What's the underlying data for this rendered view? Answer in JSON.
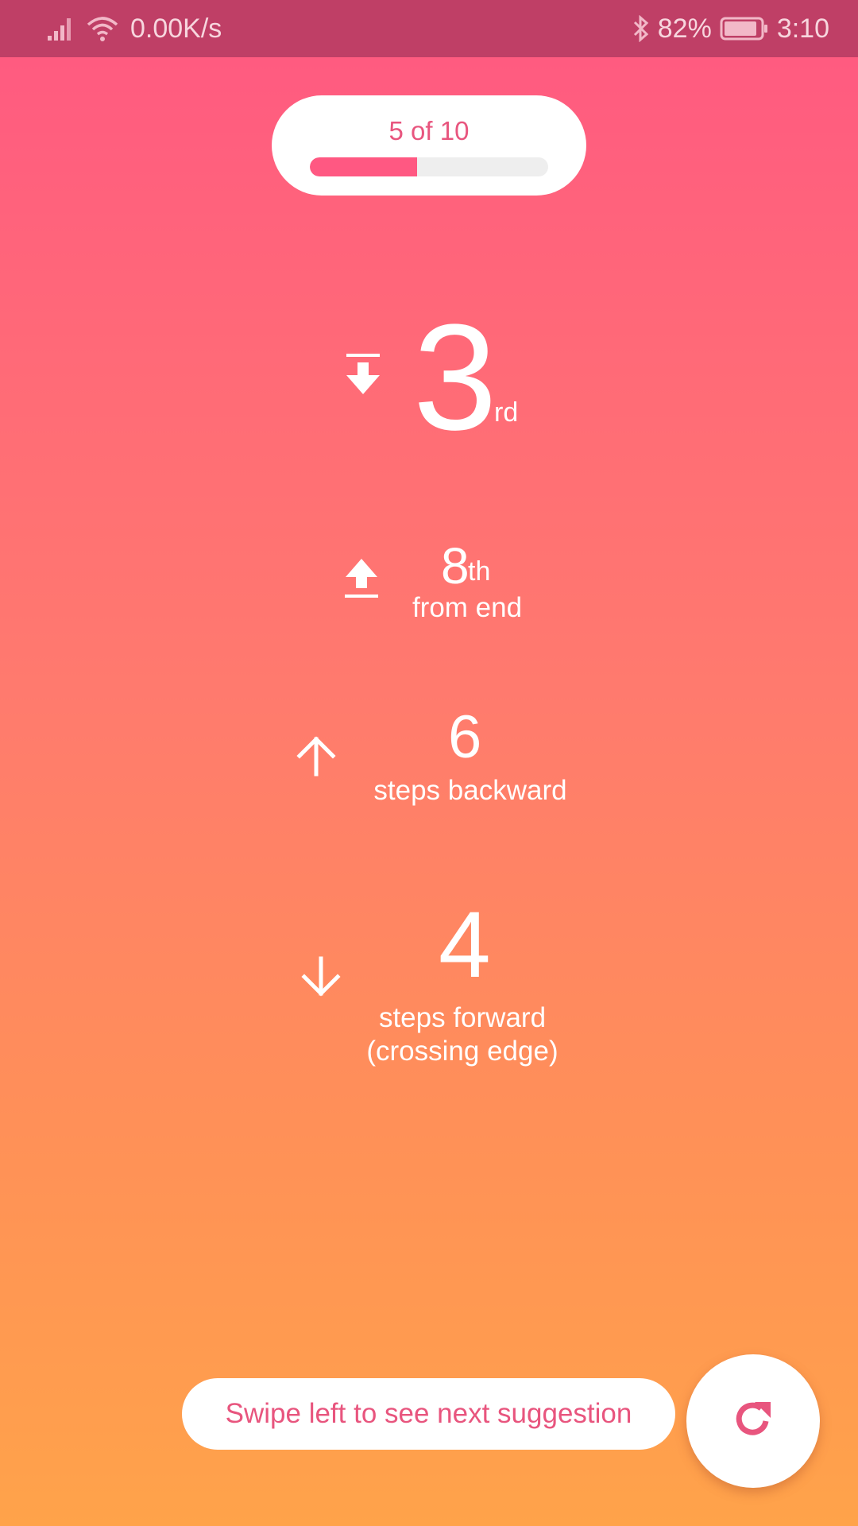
{
  "status_bar": {
    "net_speed": "0.00K/s",
    "battery": "82%",
    "time": "3:10"
  },
  "progress": {
    "label": "5 of 10",
    "fraction": 0.45
  },
  "positions": [
    {
      "value": "3",
      "suffix": "rd",
      "icon": "move-to-top-icon"
    },
    {
      "value": "8",
      "suffix": "th",
      "caption": "from end",
      "icon": "move-to-bottom-icon"
    },
    {
      "value": "6",
      "caption": "steps backward",
      "icon": "arrow-up-icon"
    },
    {
      "value": "4",
      "caption_line1": "steps forward",
      "caption_line2": "(crossing edge)",
      "icon": "arrow-down-icon"
    }
  ],
  "hint": "Swipe left to see next suggestion",
  "colors": {
    "accent": "#E8557E",
    "status_bar": "#BF3F66",
    "gradient_top": "#FF5882",
    "gradient_bottom": "#FFA34A"
  }
}
